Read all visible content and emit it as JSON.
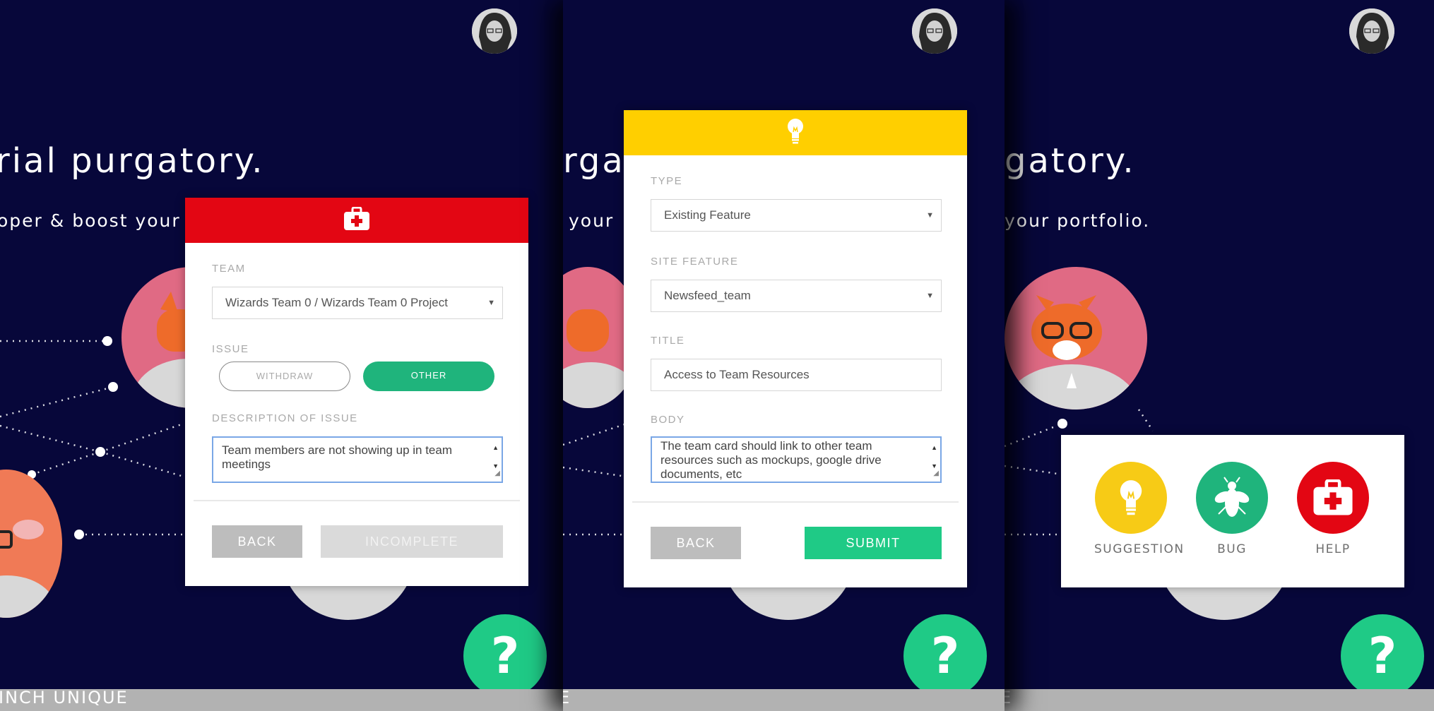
{
  "background": {
    "heading_fragment_p1": "rial purgatory.",
    "heading_fragment_p2": "rgat",
    "heading_fragment_p3": "gatory.",
    "sub_fragment_p1": "oper & boost your p",
    "sub_fragment_p2": "your",
    "sub_fragment_p3": "your portfolio.",
    "footer_fragment_p1": "INCH UNIQUE",
    "footer_fragment_p2": "E",
    "footer_fragment_p3": "E"
  },
  "help_fab": {
    "label": "?"
  },
  "help_form": {
    "team_label": "TEAM",
    "team_value": "Wizards Team 0 / Wizards Team 0 Project",
    "issue_label": "ISSUE",
    "issue_options": [
      "WITHDRAW",
      "OTHER"
    ],
    "selected_issue": "OTHER",
    "description_label": "DESCRIPTION OF ISSUE",
    "description_value": "Team members are not showing up in team meetings",
    "back_label": "BACK",
    "incomplete_label": "INCOMPLETE"
  },
  "suggestion_form": {
    "type_label": "TYPE",
    "type_value": "Existing Feature",
    "site_feature_label": "SITE FEATURE",
    "site_feature_value": "Newsfeed_team",
    "title_label": "TITLE",
    "title_value": "Access to Team Resources",
    "body_label": "BODY",
    "body_value": "The team card should link to other team resources such as mockups, google drive documents, etc",
    "back_label": "BACK",
    "submit_label": "SUBMIT"
  },
  "feedback_menu": {
    "items": [
      {
        "label": "SUGGESTION",
        "icon": "lightbulb-icon",
        "color": "#f7cb16"
      },
      {
        "label": "BUG",
        "icon": "bug-icon",
        "color": "#1fb47c"
      },
      {
        "label": "HELP",
        "icon": "first-aid-kit-icon",
        "color": "#e30613"
      }
    ]
  },
  "colors": {
    "background": "#07073a",
    "help_header": "#e30613",
    "suggestion_header": "#ffcf00",
    "accent_green": "#1fca86",
    "button_gray": "#bdbdbd",
    "button_disabled": "#dadada"
  }
}
